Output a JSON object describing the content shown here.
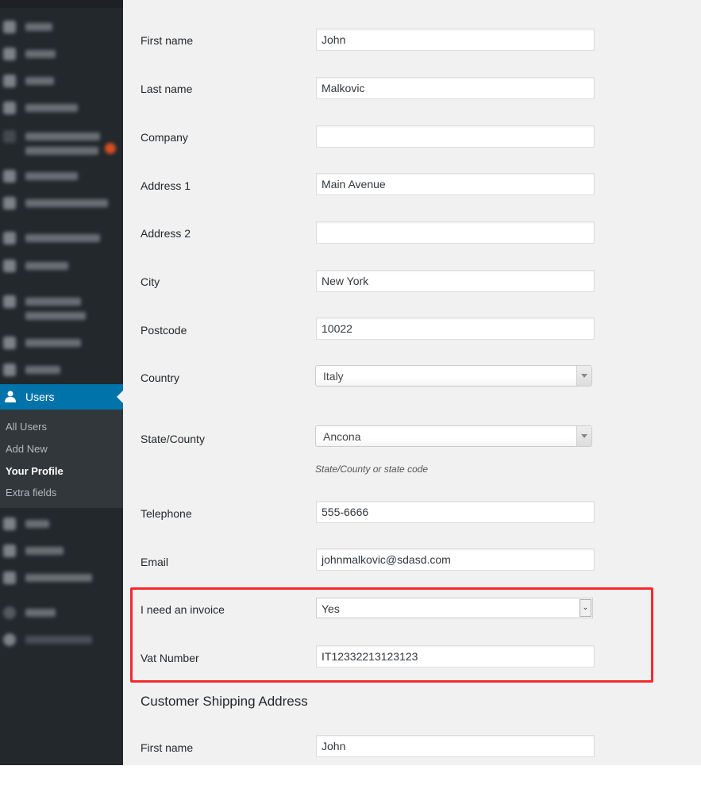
{
  "sidebar": {
    "active_item": {
      "label": "Users",
      "icon": "user-icon"
    },
    "submenu": [
      {
        "label": "All Users"
      },
      {
        "label": "Add New"
      },
      {
        "label": "Your Profile",
        "current": true
      },
      {
        "label": "Extra fields"
      }
    ],
    "accent_color": "#0073aa"
  },
  "form": {
    "billing": {
      "first_name": {
        "label": "First name",
        "value": "John"
      },
      "last_name": {
        "label": "Last name",
        "value": "Malkovic"
      },
      "company": {
        "label": "Company",
        "value": ""
      },
      "address_1": {
        "label": "Address 1",
        "value": "Main Avenue"
      },
      "address_2": {
        "label": "Address 2",
        "value": ""
      },
      "city": {
        "label": "City",
        "value": "New York"
      },
      "postcode": {
        "label": "Postcode",
        "value": "10022"
      },
      "country": {
        "label": "Country",
        "value": "Italy"
      },
      "state": {
        "label": "State/County",
        "value": "Ancona",
        "help": "State/County or state code"
      },
      "telephone": {
        "label": "Telephone",
        "value": "555-6666"
      },
      "email": {
        "label": "Email",
        "value": "johnmalkovic@sdasd.com"
      },
      "invoice": {
        "label": "I need an invoice",
        "value": "Yes"
      },
      "vat": {
        "label": "Vat Number",
        "value": "IT12332213123123"
      }
    },
    "shipping": {
      "title": "Customer Shipping Address",
      "first_name": {
        "label": "First name",
        "value": "John"
      }
    }
  },
  "highlight_color": "#f42a2f"
}
